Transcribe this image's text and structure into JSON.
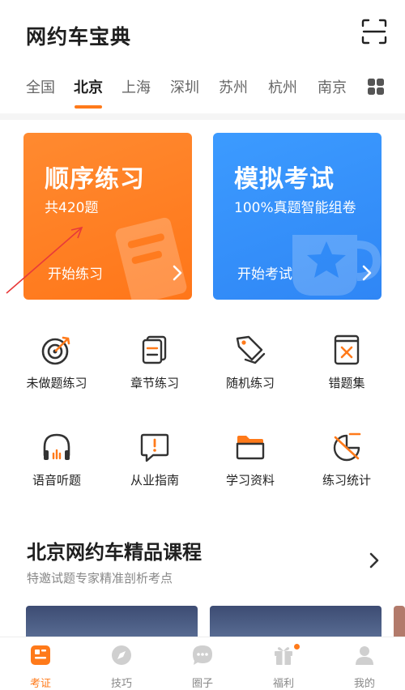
{
  "app": {
    "title": "网约车宝典"
  },
  "city_tabs": [
    {
      "label": "全国"
    },
    {
      "label": "北京",
      "active": true
    },
    {
      "label": "上海"
    },
    {
      "label": "深圳"
    },
    {
      "label": "苏州"
    },
    {
      "label": "杭州"
    },
    {
      "label": "南京"
    }
  ],
  "cards": {
    "sequential": {
      "title": "顺序练习",
      "subtitle": "共420题",
      "action": "开始练习"
    },
    "mock": {
      "title": "模拟考试",
      "subtitle": "100%真题智能组卷",
      "action": "开始考试"
    }
  },
  "tools": [
    {
      "label": "未做题练习",
      "icon": "target-icon"
    },
    {
      "label": "章节练习",
      "icon": "chapter-icon"
    },
    {
      "label": "随机练习",
      "icon": "tags-icon"
    },
    {
      "label": "错题集",
      "icon": "wrong-book-icon"
    },
    {
      "label": "语音听题",
      "icon": "headphones-icon"
    },
    {
      "label": "从业指南",
      "icon": "guide-icon"
    },
    {
      "label": "学习资料",
      "icon": "folder-icon"
    },
    {
      "label": "练习统计",
      "icon": "stats-icon"
    }
  ],
  "course_section": {
    "title": "北京网约车精品课程",
    "subtitle": "特邀试题专家精准剖析考点"
  },
  "bottom_nav": [
    {
      "label": "考证",
      "icon": "license-icon",
      "active": true
    },
    {
      "label": "技巧",
      "icon": "compass-icon"
    },
    {
      "label": "圈子",
      "icon": "chat-icon"
    },
    {
      "label": "福利",
      "icon": "gift-icon",
      "badge": true
    },
    {
      "label": "我的",
      "icon": "profile-icon"
    }
  ],
  "colors": {
    "accent": "#ff7a1a",
    "blue_card": "#3290f8",
    "orange_card": "#ff7d22"
  }
}
